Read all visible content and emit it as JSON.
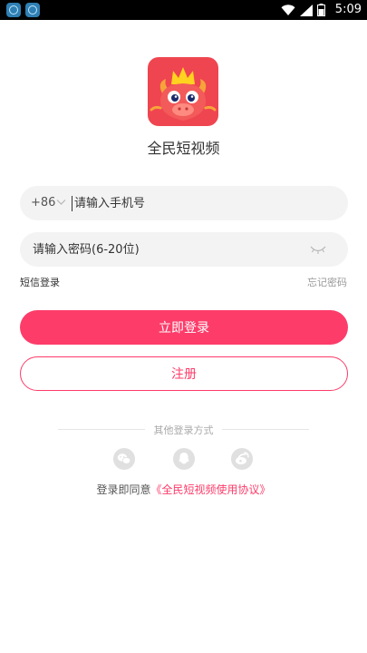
{
  "status_bar": {
    "time": "5:09"
  },
  "app": {
    "name": "全民短视频"
  },
  "login": {
    "country_code": "+86",
    "phone_placeholder": "请输入手机号",
    "password_placeholder": "请输入密码(6-20位)",
    "sms_login_label": "短信登录",
    "forgot_password_label": "忘记密码",
    "login_button": "立即登录",
    "register_button": "注册"
  },
  "other_login": {
    "title": "其他登录方式",
    "methods": [
      "wechat-icon",
      "qq-icon",
      "weibo-icon"
    ]
  },
  "agreement": {
    "prefix": "登录即同意",
    "link": "《全民短视频使用协议》"
  },
  "colors": {
    "accent": "#fd3c6a",
    "logo_bg": "#ef4550",
    "field_bg": "#f3f3f3",
    "status_bar_bg": "#000000"
  }
}
